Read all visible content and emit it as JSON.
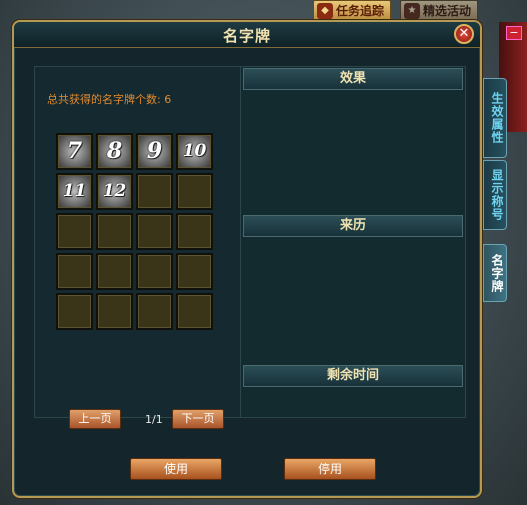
{
  "top_buttons": {
    "task_tracker": "任务追踪",
    "featured_events": "精选活动"
  },
  "window": {
    "title": "名字牌",
    "close_glyph": "✕"
  },
  "left": {
    "count_label": "总共获得的名字牌个数:",
    "count_value": "6",
    "slots": [
      "7",
      "8",
      "9",
      "10",
      "11",
      "12",
      "",
      "",
      "",
      "",
      "",
      "",
      "",
      "",
      "",
      "",
      "",
      "",
      "",
      ""
    ],
    "prev_page": "上一页",
    "page_indicator": "1/1",
    "next_page": "下一页"
  },
  "right": {
    "effect_header": "效果",
    "origin_header": "来历",
    "remaining_time_header": "剩余时间"
  },
  "side_tabs": {
    "effect_attr": "生效属性",
    "show_title": "显示称号",
    "name_card": "名字牌"
  },
  "actions": {
    "use": "使用",
    "disable": "停用"
  }
}
